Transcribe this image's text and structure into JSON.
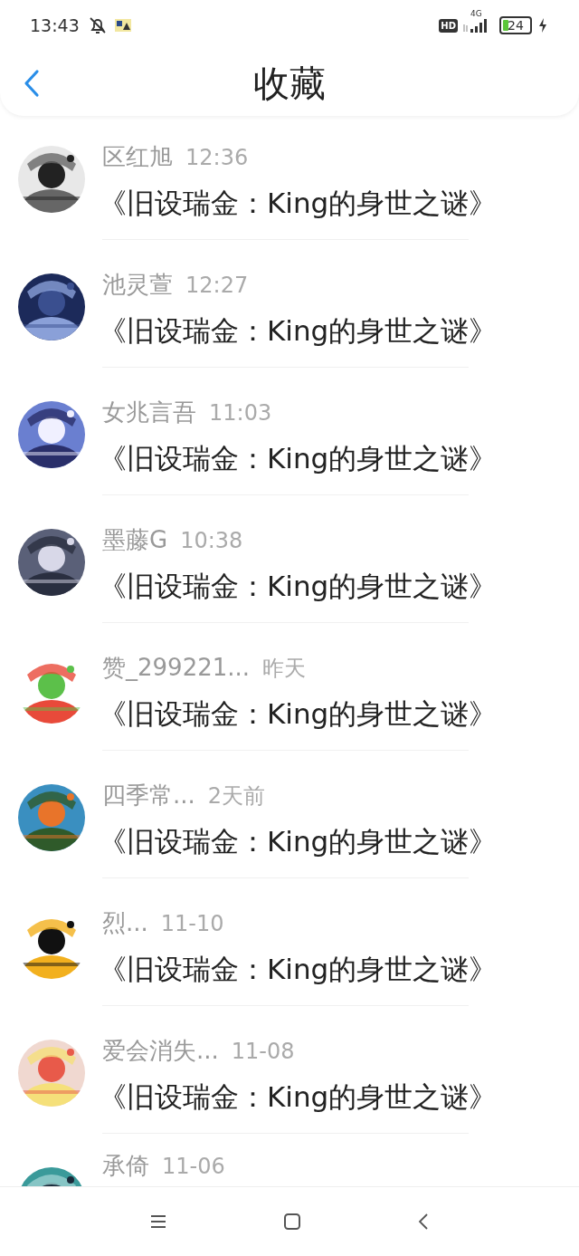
{
  "status_bar": {
    "time": "13:43",
    "hd": "HD",
    "network": "4G",
    "battery": "24"
  },
  "header": {
    "title": "收藏"
  },
  "items": [
    {
      "name": "区红旭",
      "time": "12:36",
      "title": "《旧设瑞金：King的身世之谜》"
    },
    {
      "name": "池灵萱",
      "time": "12:27",
      "title": "《旧设瑞金：King的身世之谜》"
    },
    {
      "name": "女兆言吾",
      "time": "11:03",
      "title": "《旧设瑞金：King的身世之谜》"
    },
    {
      "name": "墨藤G",
      "time": "10:38",
      "title": "《旧设瑞金：King的身世之谜》"
    },
    {
      "name": "赞_299221...",
      "time": "昨天",
      "title": "《旧设瑞金：King的身世之谜》"
    },
    {
      "name": "四季常...",
      "time": "2天前",
      "title": "《旧设瑞金：King的身世之谜》"
    },
    {
      "name": "烈...",
      "time": "11-10",
      "title": "《旧设瑞金：King的身世之谜》"
    },
    {
      "name": "爱会消失...",
      "time": "11-08",
      "title": "《旧设瑞金：King的身世之谜》"
    },
    {
      "name": "承倚",
      "time": "11-06"
    }
  ]
}
